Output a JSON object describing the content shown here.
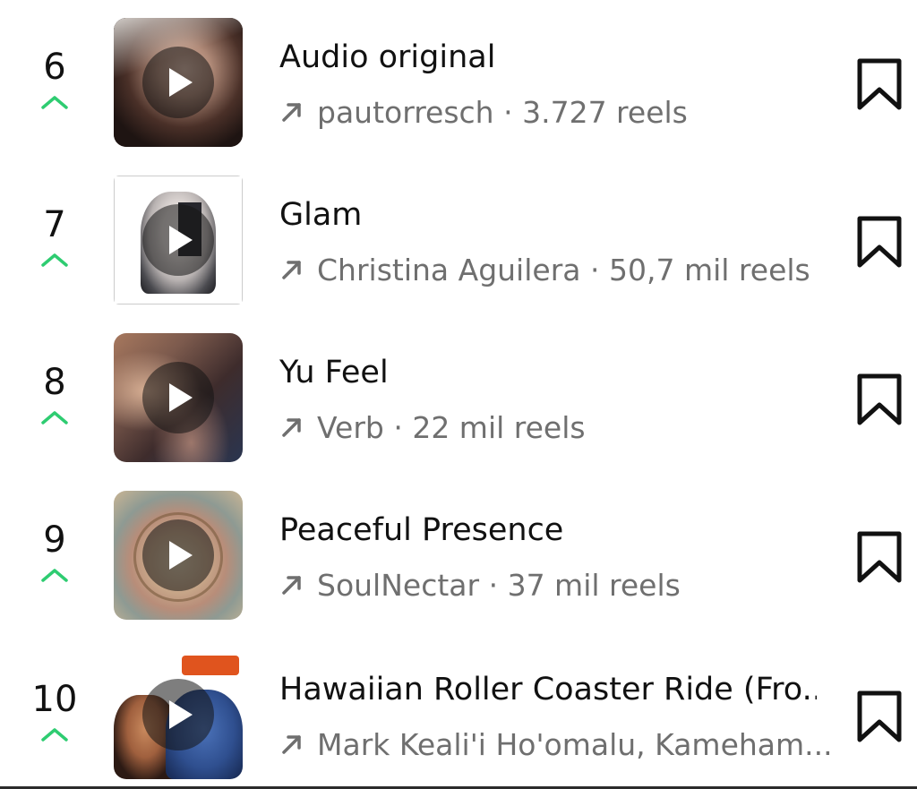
{
  "rows": [
    {
      "rank": "6",
      "title": "Audio original",
      "artist": "pautorresch",
      "separator": " · ",
      "reels": "3.727 reels",
      "thumb_icon": "audio-original-thumbnail"
    },
    {
      "rank": "7",
      "title": "Glam",
      "artist": "Christina Aguilera",
      "separator": " · ",
      "reels": "50,7 mil reels",
      "thumb_icon": "album-art-thumbnail"
    },
    {
      "rank": "8",
      "title": "Yu Feel",
      "artist": "Verb",
      "separator": " · ",
      "reels": "22 mil reels",
      "thumb_icon": "hands-thumbnail"
    },
    {
      "rank": "9",
      "title": "Peaceful Presence",
      "artist": "SoulNectar",
      "separator": " · ",
      "reels": "37 mil reels",
      "thumb_icon": "ornate-cover-thumbnail"
    },
    {
      "rank": "10",
      "title": "Hawaiian Roller Coaster Ride (Fro...",
      "artist": "Mark Keali'i Ho'omalu, Kameham...",
      "separator": "",
      "reels": "",
      "thumb_icon": "lilo-stitch-thumbnail"
    }
  ],
  "colors": {
    "trend_up": "#2ecc71",
    "text_primary": "#111111",
    "text_secondary": "#6f6f6f"
  }
}
